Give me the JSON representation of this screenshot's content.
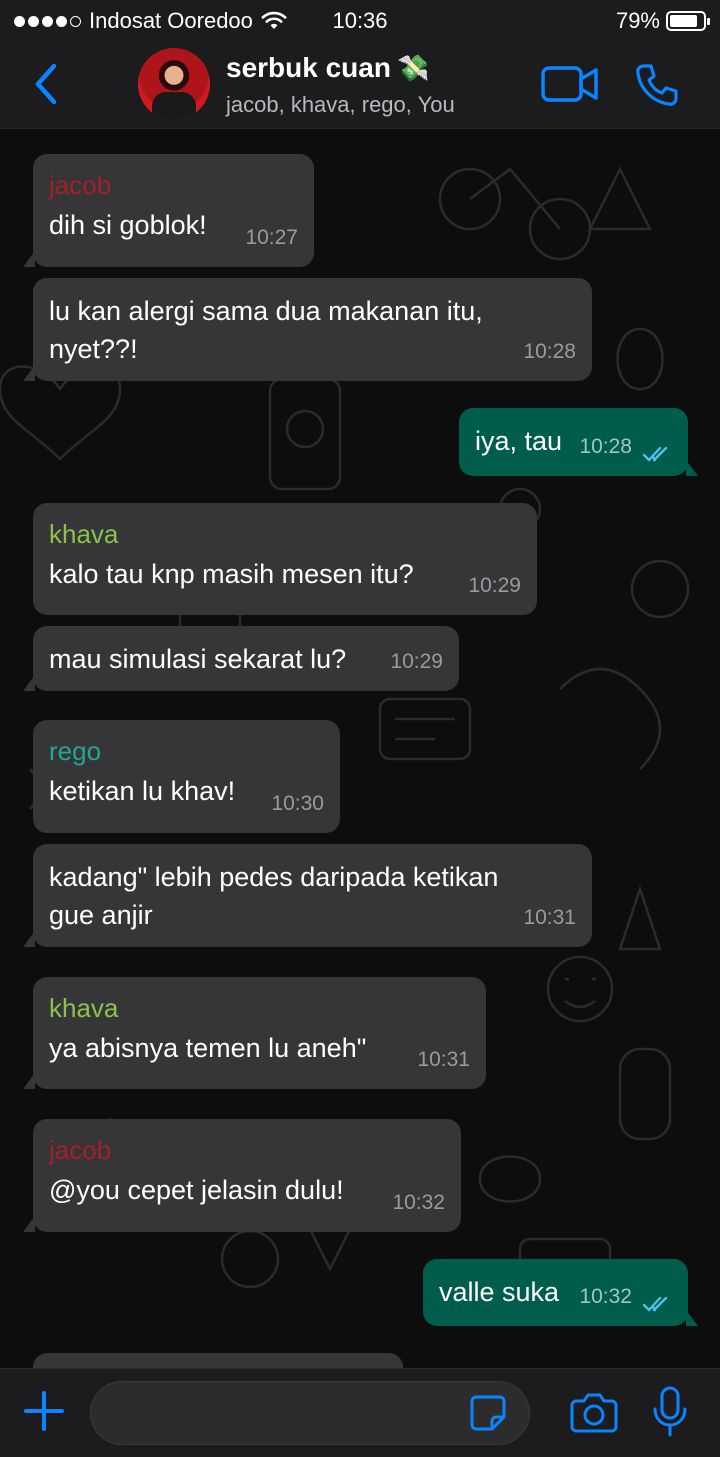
{
  "status_bar": {
    "carrier": "Indosat Ooredoo",
    "time": "10:36",
    "battery": "79%",
    "battery_level": 0.79
  },
  "header": {
    "title": "serbuk cuan",
    "title_emoji": "💸",
    "members": "jacob, khava, rego, You",
    "icons": [
      "back-chevron-icon",
      "group-avatar",
      "video-call-icon",
      "phone-call-icon"
    ]
  },
  "messages": [
    {
      "sender": "jacob",
      "text": "dih si goblok!",
      "time": "10:27"
    },
    {
      "text": "lu kan alergi sama dua makanan itu,",
      "text2": "nyet??!",
      "time": "10:28"
    },
    {
      "text": "iya, tau",
      "time": "10:28",
      "outgoing": true
    },
    {
      "sender": "khava",
      "text": "kalo tau knp masih mesen itu?",
      "time": "10:29"
    },
    {
      "text": "mau simulasi sekarat lu?",
      "time": "10:29"
    },
    {
      "sender": "rego",
      "text": "ketikan lu khav!",
      "time": "10:30"
    },
    {
      "text": "kadang\" lebih pedes daripada ketikan",
      "text2": "gue anjir",
      "time": "10:31"
    },
    {
      "sender": "khava",
      "text": "ya abisnya temen lu aneh\"",
      "time": "10:31"
    },
    {
      "sender": "jacob",
      "text": "@you cepet jelasin dulu!",
      "time": "10:32"
    },
    {
      "text": "valle suka",
      "time": "10:32",
      "outgoing": true
    }
  ],
  "colors": {
    "accent": "#0a84ff",
    "incoming_bubble": "#363638",
    "outgoing_bubble": "#005c4b",
    "sender_jacob": "#a3202a",
    "sender_khava": "#8bc34a",
    "sender_rego": "#1fa88f",
    "read_ticks": "#53bdeb"
  },
  "composer": {
    "placeholder": "",
    "icons": [
      "plus-icon",
      "sticker-icon",
      "camera-icon",
      "mic-icon"
    ]
  }
}
